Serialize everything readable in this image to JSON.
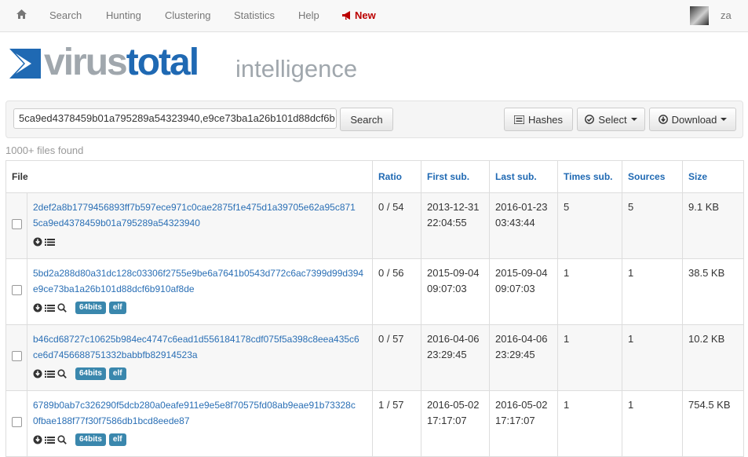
{
  "nav": {
    "items": [
      "Search",
      "Hunting",
      "Clustering",
      "Statistics",
      "Help"
    ],
    "new_label": "New",
    "user": "za"
  },
  "logo": {
    "virus": "virus",
    "total": "total",
    "intelligence": "intelligence"
  },
  "search": {
    "query": "5ca9ed4378459b01a795289a54323940,e9ce73ba1a26b101d88dcf6b",
    "search_label": "Search",
    "hashes_label": "Hashes",
    "select_label": "Select",
    "download_label": "Download"
  },
  "files_found": "1000+ files found",
  "table": {
    "headers": [
      "File",
      "Ratio",
      "First sub.",
      "Last sub.",
      "Times sub.",
      "Sources",
      "Size"
    ],
    "rows": [
      {
        "hash1": "2def2a8b1779456893ff7b597ece971c0cae2875f1e475d1a39705e62a95c871",
        "hash2": "5ca9ed4378459b01a795289a54323940",
        "ratio": "0 / 54",
        "first_date": "2013-12-31",
        "first_time": "22:04:55",
        "last_date": "2016-01-23",
        "last_time": "03:43:44",
        "times": "5",
        "sources": "5",
        "size": "9.1 KB",
        "tags": []
      },
      {
        "hash1": "5bd2a288d80a31dc128c03306f2755e9be6a7641b0543d772c6ac7399d99d394",
        "hash2": "e9ce73ba1a26b101d88dcf6b910af8de",
        "ratio": "0 / 56",
        "first_date": "2015-09-04",
        "first_time": "09:07:03",
        "last_date": "2015-09-04",
        "last_time": "09:07:03",
        "times": "1",
        "sources": "1",
        "size": "38.5 KB",
        "tags": [
          "64bits",
          "elf"
        ]
      },
      {
        "hash1": "b46cd68727c10625b984ec4747c6ead1d556184178cdf075f5a398c8eea435c6",
        "hash2": "ce6d7456688751332babbfb82914523a",
        "ratio": "0 / 57",
        "first_date": "2016-04-06",
        "first_time": "23:29:45",
        "last_date": "2016-04-06",
        "last_time": "23:29:45",
        "times": "1",
        "sources": "1",
        "size": "10.2 KB",
        "tags": [
          "64bits",
          "elf"
        ]
      },
      {
        "hash1": "6789b0ab7c326290f5dcb280a0eafe911e9e5e8f70575fd08ab9eae91b73328c",
        "hash2": "0fbae188f77f30f7586db1bcd8eede87",
        "ratio": "1 / 57",
        "first_date": "2016-05-02",
        "first_time": "17:17:07",
        "last_date": "2016-05-02",
        "last_time": "17:17:07",
        "times": "1",
        "sources": "1",
        "size": "754.5 KB",
        "tags": [
          "64bits",
          "elf"
        ]
      }
    ]
  },
  "colors": {
    "link": "#2a6fb5",
    "brand_blue": "#1f69b3",
    "brand_gray": "#a0a7ad",
    "new_red": "#b00000",
    "tag": "#3a87ad"
  }
}
